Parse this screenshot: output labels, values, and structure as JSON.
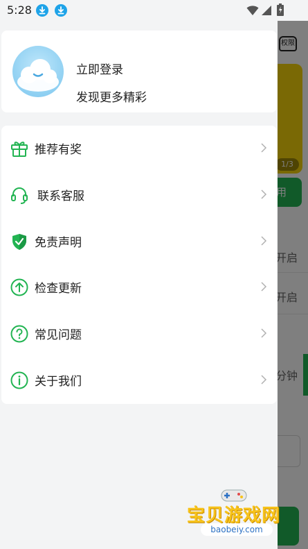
{
  "status_bar": {
    "time": "5:28",
    "icons": [
      "download-icon",
      "download-icon",
      "wifi-icon",
      "signal-icon",
      "battery-icon"
    ]
  },
  "background": {
    "permission_label": "权限",
    "pager": "1/3",
    "button_partial": "用",
    "text_1": "开启",
    "text_2": "开启",
    "text_3": "分钟"
  },
  "profile": {
    "login": "立即登录",
    "subtitle": "发现更多精彩"
  },
  "menu": {
    "items": [
      {
        "label": "推荐有奖",
        "icon": "gift-icon"
      },
      {
        "label": "联系客服",
        "icon": "headset-icon"
      },
      {
        "label": "免责声明",
        "icon": "shield-check-icon"
      },
      {
        "label": "检查更新",
        "icon": "update-arrow-icon"
      },
      {
        "label": "常见问题",
        "icon": "question-icon"
      },
      {
        "label": "关于我们",
        "icon": "info-icon"
      }
    ]
  },
  "watermark": {
    "main": "宝贝游戏网",
    "sub": "baobeiy.com"
  },
  "colors": {
    "accent_green": "#22b452",
    "download_blue": "#1ea3e8",
    "banner_yellow": "#f5d20a"
  }
}
